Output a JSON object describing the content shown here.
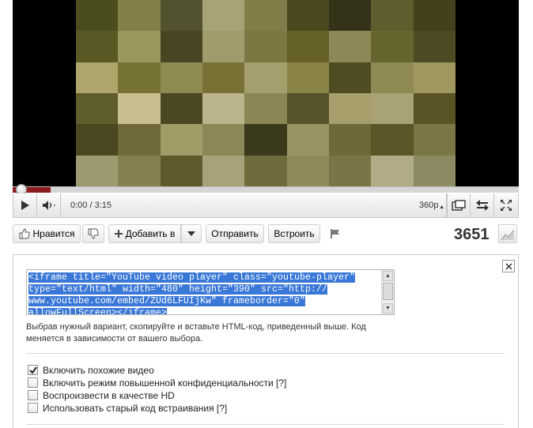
{
  "player": {
    "time": "0:00 / 3:15",
    "quality": "360p",
    "frame_colors": [
      "#4c4d1e",
      "#828048",
      "#535230",
      "#a7a377",
      "#817e4a",
      "#4a481f",
      "#35321a",
      "#5f5c2e",
      "#43401c",
      "#5a5825",
      "#9c965f",
      "#494522",
      "#a09c6c",
      "#7d7843",
      "#656128",
      "#8d8855",
      "#67652f",
      "#4d4b24",
      "#ada56c",
      "#777334",
      "#8e8a52",
      "#777136",
      "#a4a06d",
      "#8a8547",
      "#4f4c22",
      "#8f8a53",
      "#9e9760",
      "#5f5d2c",
      "#c7bf8d",
      "#4b4721",
      "#bcb48a",
      "#8a8656",
      "#585429",
      "#a69f6b",
      "#a9a274",
      "#585426",
      "#4a4820",
      "#6f6a37",
      "#a19b67",
      "#8c8756",
      "#3b391c",
      "#999461",
      "#6d6a38",
      "#5b5528",
      "#7b7645",
      "#9d9a70",
      "#85804f",
      "#5e5a2c",
      "#a7a27a",
      "#6f6b3c",
      "#8f8a5a",
      "#7a7547",
      "#b1ac86",
      "#8c8a63"
    ]
  },
  "actions": {
    "like_label": "Нравится",
    "add_label": "Добавить в",
    "share_label": "Отправить",
    "embed_label": "Встроить",
    "view_count": "3651"
  },
  "embed": {
    "code_lines": [
      "<iframe title=\"YouTube video player\" class=\"youtube-player\"",
      "type=\"text/html\" width=\"480\" height=\"390\" src=\"http://",
      "www.youtube.com/embed/ZUd6LFUIjKw\" frameborder=\"0\"",
      "allowFullScreen></iframe>"
    ],
    "hint": "Выбрав нужный вариант, скопируйте и вставьте HTML-код, приведенный выше. Код меняется в зависимости от вашего выбора.",
    "options": [
      {
        "label": "Включить похожие видео",
        "checked": true
      },
      {
        "label": "Включить режим повышенной конфиденциальности [?]",
        "checked": false
      },
      {
        "label": "Воспроизвести в качестве HD",
        "checked": false
      },
      {
        "label": "Использовать старый код встраивания [?]",
        "checked": false
      }
    ]
  },
  "icons": {
    "play": "play-icon",
    "volume": "volume-icon",
    "popout": "popout-icon",
    "fullscreen": "fullscreen-icon",
    "like": "thumbs-up-icon",
    "dislike": "thumbs-down-icon",
    "add": "plus-icon",
    "flag": "flag-icon",
    "stats": "stats-chart-icon",
    "close": "close-icon"
  }
}
